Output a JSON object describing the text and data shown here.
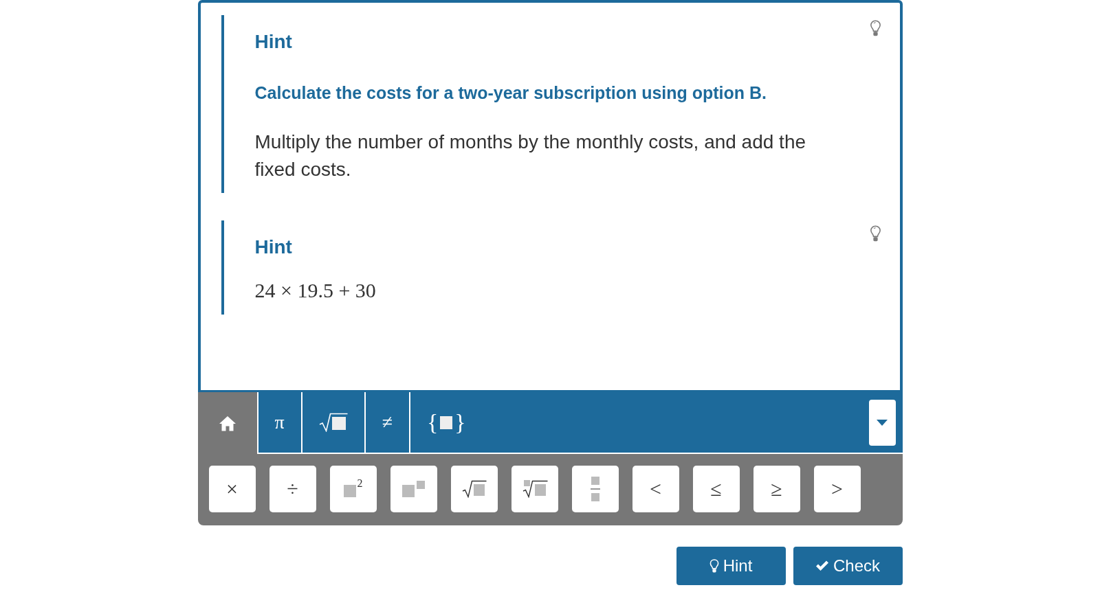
{
  "hints": [
    {
      "title": "Hint",
      "paragraphs": [
        {
          "kind": "question",
          "text": "Calculate the costs for a two-year subscription using option B."
        },
        {
          "kind": "text",
          "text": "Multiply the number of months by the monthly costs, and add the fixed costs."
        }
      ]
    },
    {
      "title": "Hint",
      "paragraphs": [
        {
          "kind": "math",
          "text": "24 × 19.5 + 30"
        }
      ]
    }
  ],
  "keyboard": {
    "tabs": [
      {
        "kind": "home",
        "selected": true
      },
      {
        "kind": "symbol",
        "label": "π",
        "selected": false
      },
      {
        "kind": "sqrt",
        "selected": false
      },
      {
        "kind": "symbol",
        "label": "≠",
        "selected": false
      },
      {
        "kind": "braces",
        "open": "{",
        "close": "}",
        "selected": false
      }
    ],
    "keys": [
      {
        "kind": "symbol",
        "label": "×"
      },
      {
        "kind": "symbol",
        "label": "÷"
      },
      {
        "kind": "square",
        "label": "2"
      },
      {
        "kind": "power"
      },
      {
        "kind": "sqrt"
      },
      {
        "kind": "nthroot"
      },
      {
        "kind": "fraction"
      },
      {
        "kind": "symbol",
        "label": "<"
      },
      {
        "kind": "symbol",
        "label": "≤"
      },
      {
        "kind": "symbol",
        "label": "≥"
      },
      {
        "kind": "symbol",
        "label": ">"
      }
    ]
  },
  "buttons": [
    {
      "kind": "hint",
      "label": "Hint"
    },
    {
      "kind": "check",
      "label": "Check"
    }
  ]
}
